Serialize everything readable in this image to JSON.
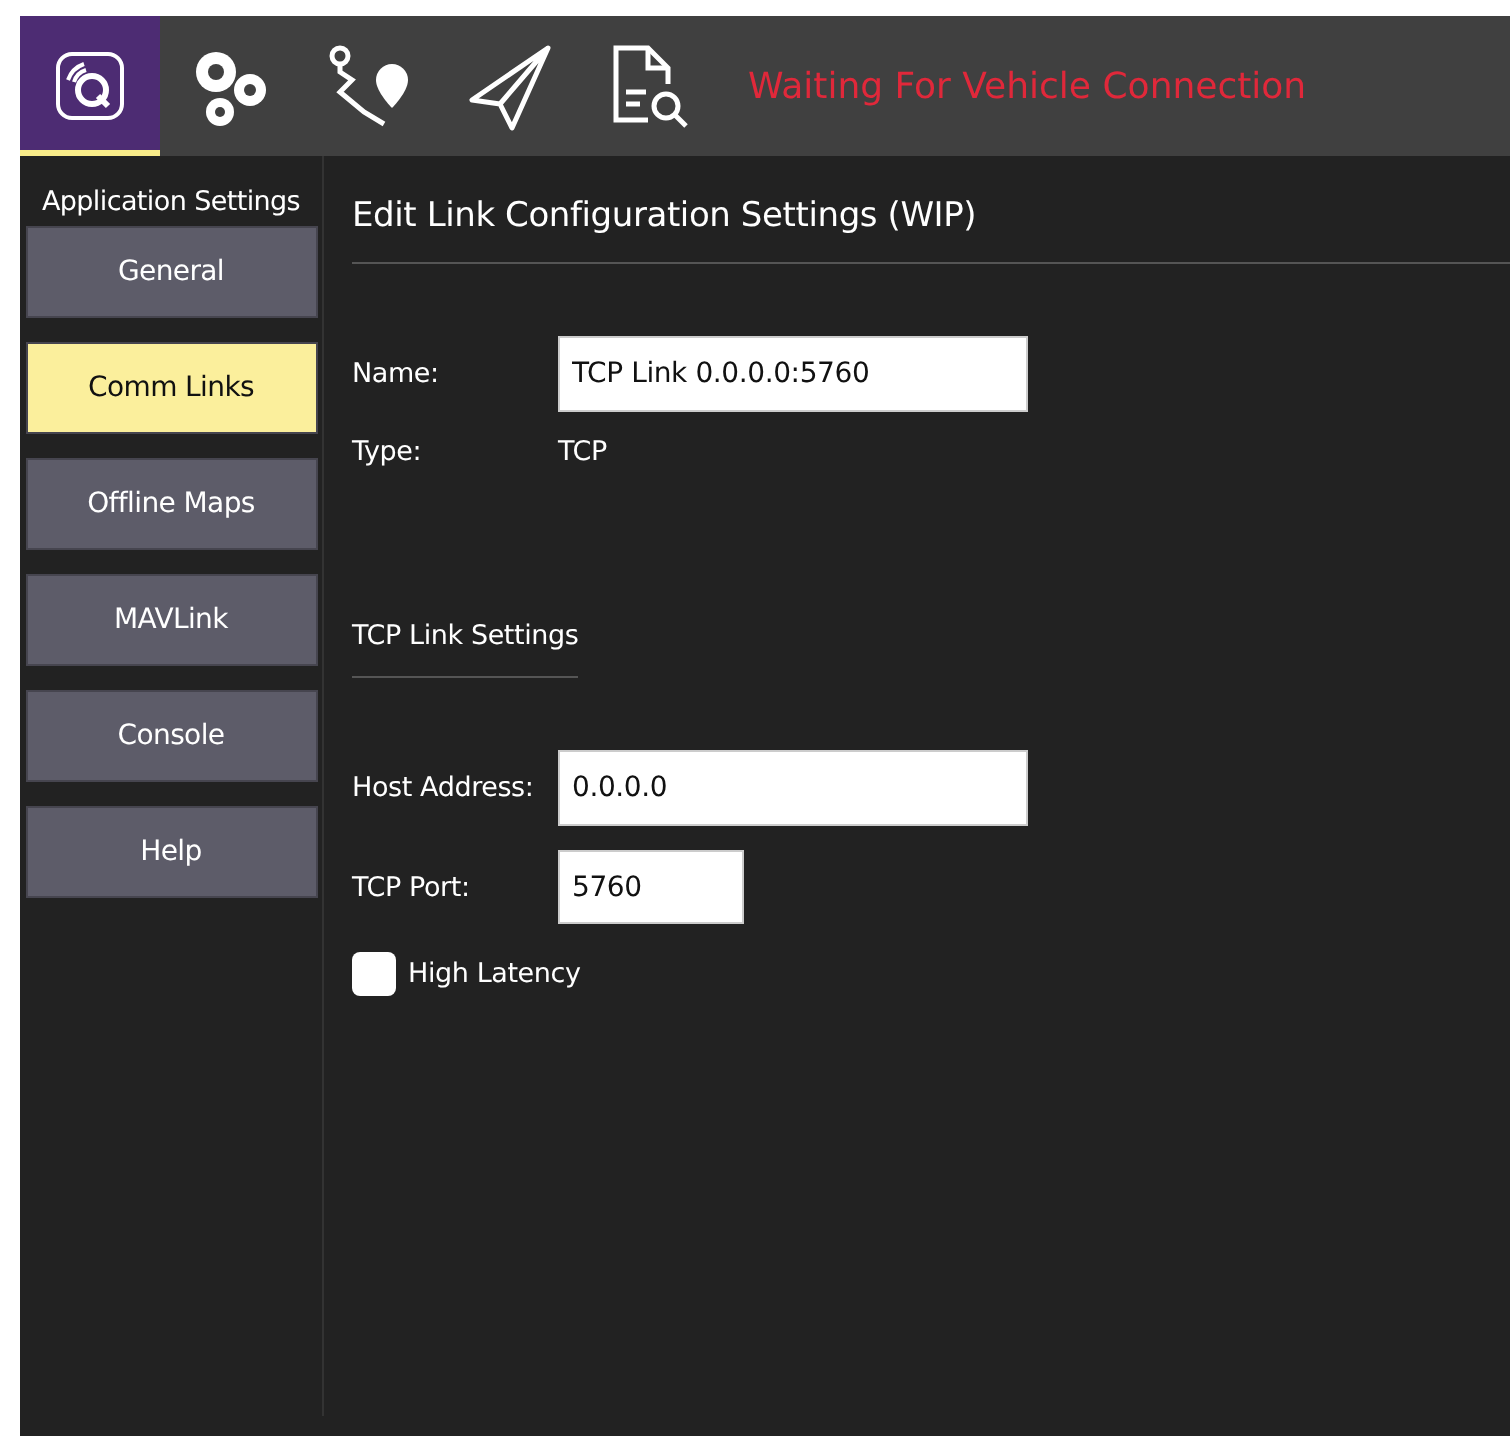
{
  "toolbar": {
    "tools": [
      {
        "kind": "app",
        "selected": true
      },
      {
        "kind": "settings",
        "selected": false
      },
      {
        "kind": "plan",
        "selected": false
      },
      {
        "kind": "fly",
        "selected": false
      },
      {
        "kind": "analyze",
        "selected": false
      }
    ],
    "status": "Waiting For Vehicle Connection"
  },
  "sidebar": {
    "title": "Application Settings",
    "items": [
      {
        "label": "General",
        "selected": false
      },
      {
        "label": "Comm Links",
        "selected": true
      },
      {
        "label": "Offline Maps",
        "selected": false
      },
      {
        "label": "MAVLink",
        "selected": false
      },
      {
        "label": "Console",
        "selected": false
      },
      {
        "label": "Help",
        "selected": false
      }
    ]
  },
  "editor": {
    "title": "Edit Link Configuration Settings (WIP)",
    "name": {
      "label": "Name:",
      "value": "TCP Link 0.0.0.0:5760"
    },
    "type": {
      "label": "Type:",
      "value": "TCP"
    },
    "section": "TCP Link Settings",
    "host": {
      "label": "Host Address:",
      "value": "0.0.0.0"
    },
    "port": {
      "label": "TCP Port:",
      "value": "5760"
    },
    "high_latency": {
      "label": "High Latency",
      "checked": false
    }
  }
}
